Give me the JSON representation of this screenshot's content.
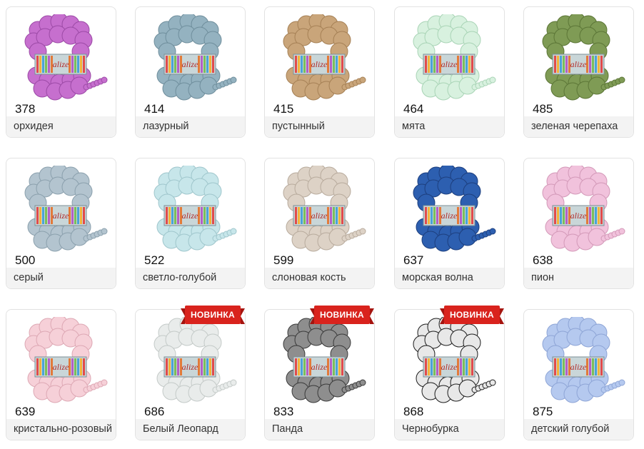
{
  "products": [
    {
      "code": "378",
      "name": "орхидея",
      "color": "#c66fce",
      "dark": "#9c4aa6",
      "badge": ""
    },
    {
      "code": "414",
      "name": "лазурный",
      "color": "#94b2c0",
      "dark": "#6f8e9c",
      "badge": ""
    },
    {
      "code": "415",
      "name": "пустынный",
      "color": "#c9a57a",
      "dark": "#a68156",
      "badge": ""
    },
    {
      "code": "464",
      "name": "мята",
      "color": "#d8f1df",
      "dark": "#a9d4b6",
      "badge": ""
    },
    {
      "code": "485",
      "name": "зеленая черепаха",
      "color": "#7f9b55",
      "dark": "#5c7637",
      "badge": ""
    },
    {
      "code": "500",
      "name": "серый",
      "color": "#b3c4cf",
      "dark": "#8ba0ad",
      "badge": ""
    },
    {
      "code": "522",
      "name": "светло-голубой",
      "color": "#c7e6ea",
      "dark": "#9fc6cc",
      "badge": ""
    },
    {
      "code": "599",
      "name": "слоновая кость",
      "color": "#ddd2c6",
      "dark": "#b8ab9d",
      "badge": ""
    },
    {
      "code": "637",
      "name": "морская волна",
      "color": "#2d5fb0",
      "dark": "#1d3f7e",
      "badge": ""
    },
    {
      "code": "638",
      "name": "пион",
      "color": "#f1c2dc",
      "dark": "#d399b8",
      "badge": ""
    },
    {
      "code": "639",
      "name": "кристально-розовый",
      "color": "#f6d0d8",
      "dark": "#dda8b4",
      "badge": ""
    },
    {
      "code": "686",
      "name": "Белый Леопард",
      "color": "#e9eceb",
      "dark": "#c4cac8",
      "badge": "НОВИНКА"
    },
    {
      "code": "833",
      "name": "Панда",
      "color": "#8e8e8e",
      "dark": "#3a3a3a",
      "badge": "НОВИНКА"
    },
    {
      "code": "868",
      "name": "Чернобурка",
      "color": "#e8e8e8",
      "dark": "#1c1c1c",
      "badge": "НОВИНКА"
    },
    {
      "code": "875",
      "name": "детский голубой",
      "color": "#b5c9ef",
      "dark": "#8ea5d6",
      "badge": ""
    }
  ],
  "brand_label": "alize"
}
